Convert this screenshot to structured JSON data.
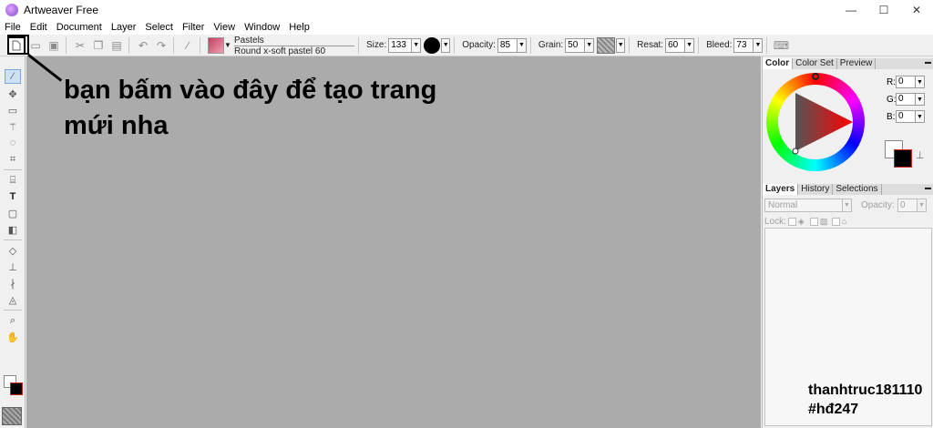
{
  "window": {
    "title": "Artweaver Free",
    "minimize": "—",
    "maximize": "☐",
    "close": "✕"
  },
  "menu": [
    "File",
    "Edit",
    "Document",
    "Layer",
    "Select",
    "Filter",
    "View",
    "Window",
    "Help"
  ],
  "toolbar": {
    "brush_category": "Pastels",
    "brush_name": "Round x-soft pastel 60",
    "size_label": "Size:",
    "size_value": "133",
    "opacity_label": "Opacity:",
    "opacity_value": "85",
    "grain_label": "Grain:",
    "grain_value": "50",
    "resat_label": "Resat:",
    "resat_value": "60",
    "bleed_label": "Bleed:",
    "bleed_value": "73"
  },
  "annotation": {
    "text": "bạn bấm vào đây để tạo trang mứi nha",
    "watermark_line1": "thanhtruc181110",
    "watermark_line2": "#hđ247"
  },
  "color_panel": {
    "tabs": [
      "Color",
      "Color Set",
      "Preview"
    ],
    "r_label": "R:",
    "r_value": "0",
    "g_label": "G:",
    "g_value": "0",
    "b_label": "B:",
    "b_value": "0"
  },
  "layers_panel": {
    "tabs": [
      "Layers",
      "History",
      "Selections"
    ],
    "blend_mode": "Normal",
    "opacity_label": "Opacity:",
    "opacity_value": "0",
    "lock_label": "Lock:"
  },
  "colors": {
    "canvas": "#ababab",
    "foreground": "#000000",
    "background": "#ffffff",
    "accent_border": "#d02020"
  }
}
